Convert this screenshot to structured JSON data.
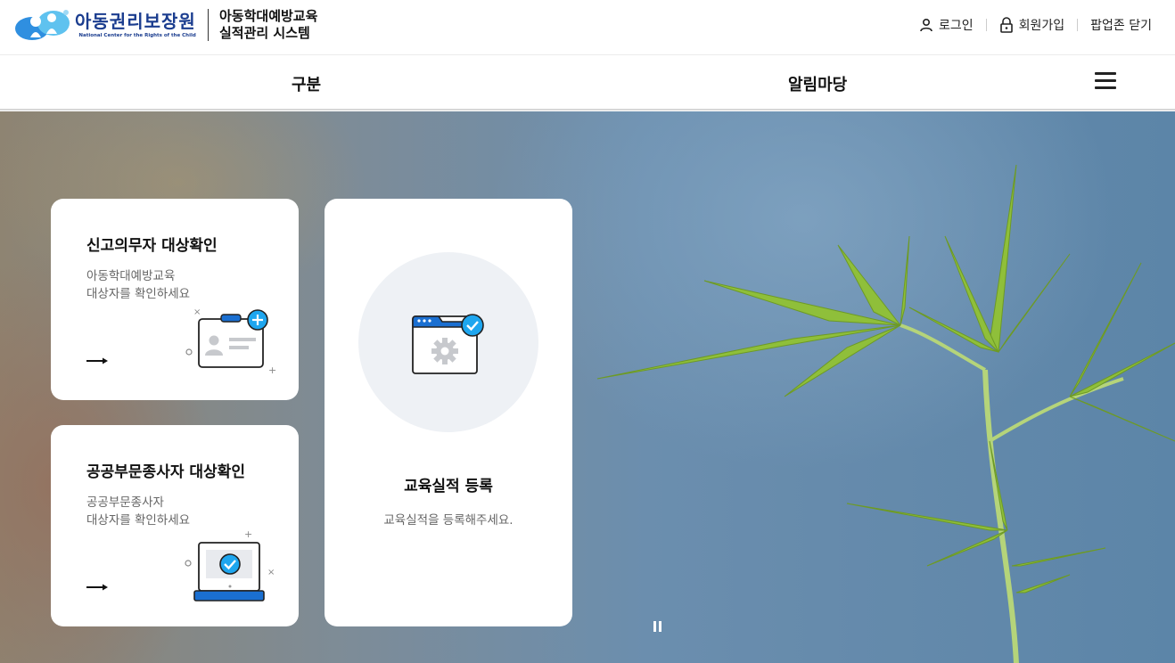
{
  "header": {
    "logo_ko": "아동권리보장원",
    "logo_en": "National Center for the Rights of the Child",
    "system_title_line1": "아동학대예방교육",
    "system_title_line2": "실적관리 시스템",
    "login": "로그인",
    "signup": "회원가입",
    "close_popup_zone": "팝업존 닫기"
  },
  "nav": {
    "items": [
      "구분",
      "알림마당"
    ]
  },
  "cards": {
    "reporter": {
      "title": "신고의무자 대상확인",
      "desc_line1": "아동학대예방교육",
      "desc_line2": "대상자를 확인하세요"
    },
    "public": {
      "title": "공공부문종사자 대상확인",
      "desc_line1": "공공부문종사자",
      "desc_line2": "대상자를 확인하세요"
    },
    "register": {
      "title": "교육실적 등록",
      "desc": "교육실적을 등록해주세요."
    }
  },
  "colors": {
    "brand_navy": "#1b3d8f",
    "accent_blue": "#1a6fd1",
    "check_blue": "#1ea6ef"
  },
  "icons": [
    "person-icon",
    "lock-icon",
    "hamburger-icon",
    "arrow-right-icon",
    "id-card-icon",
    "laptop-check-icon",
    "browser-gear-icon",
    "pause-icon"
  ]
}
